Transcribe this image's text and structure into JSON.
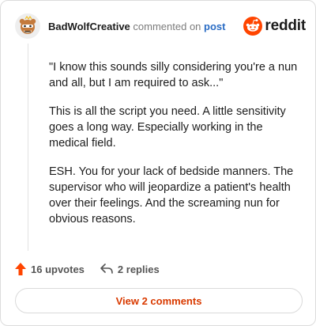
{
  "comment": {
    "author": "BadWolfCreative",
    "verb": "commented on",
    "target": "post",
    "paragraphs": [
      "\"I know this sounds silly considering you're a nun and all, but I am required to ask...\"",
      "This is all the script you need. A little sensitivity goes a long way. Especially working in the medical field.",
      "ESH. You for your lack of bedside manners. The supervisor who will jeopardize a patient's health over their feelings. And the screaming nun for obvious reasons."
    ]
  },
  "brand": {
    "word": "reddit",
    "icon": "reddit-logo-icon",
    "color": "#ff4500"
  },
  "actions": {
    "upvotes": "16 upvotes",
    "upvote_icon": "upvote-arrow-icon",
    "replies": "2 replies",
    "reply_icon": "reply-arrow-icon"
  },
  "view_comments_label": "View 2 comments",
  "colors": {
    "accent": "#d93a00",
    "link": "#2a6cc4",
    "upvote": "#ff4500"
  }
}
